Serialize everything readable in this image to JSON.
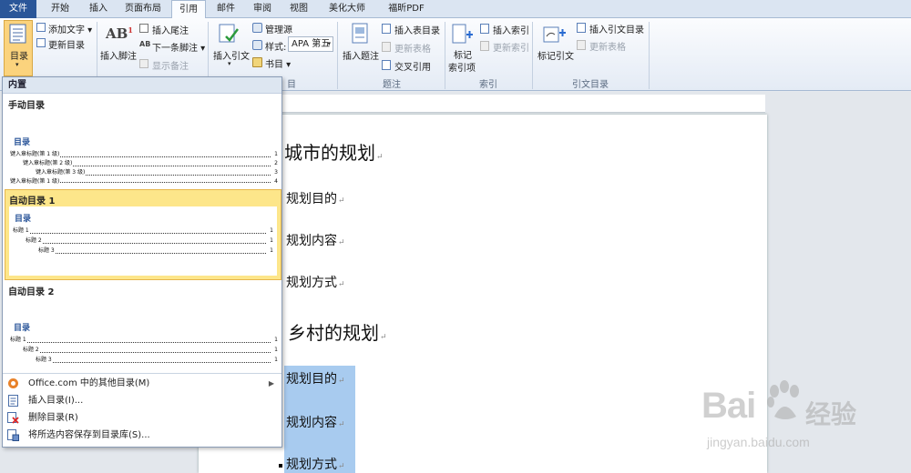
{
  "tabs": [
    "文件",
    "开始",
    "插入",
    "页面布局",
    "引用",
    "邮件",
    "审阅",
    "视图",
    "美化大师",
    "福昕PDF"
  ],
  "ribbon": {
    "toc_button": "目录",
    "add_text": "添加文字 ▾",
    "update_toc": "更新目录",
    "insert_footnote": "插入脚注",
    "insert_endnote": "插入尾注",
    "next_footnote": "下一条脚注 ▾",
    "show_notes": "显示备注",
    "insert_citation": "插入引文",
    "manage_sources": "管理源",
    "style_label": "样式:",
    "style_value": "APA 第五",
    "bibliography": "书目 ▾",
    "insert_caption": "插入题注",
    "insert_table_of_figures": "插入表目录",
    "update_table": "更新表格",
    "cross_reference": "交叉引用",
    "caption_group": "题注",
    "mark_entry": "标记\n索引项",
    "mark_entry_l1": "标记",
    "mark_entry_l2": "索引项",
    "insert_index": "插入索引",
    "update_index": "更新索引",
    "index_group": "索引",
    "mark_citation": "标记引文",
    "insert_toa": "插入引文目录",
    "update_toa": "更新表格",
    "toa_group": "引文目录",
    "citation_group_partial": "目"
  },
  "gallery": {
    "builtin_header": "内置",
    "manual_title": "手动目录",
    "manual_preview": {
      "heading": "目录",
      "lines": [
        {
          "text": "键入章标题(第 1 级)",
          "page": "1"
        },
        {
          "text": "键入章标题(第 2 级)",
          "page": "2"
        },
        {
          "text": "键入章标题(第 3 级)",
          "page": "3"
        },
        {
          "text": "键入章标题(第 1 级)",
          "page": "4"
        }
      ]
    },
    "auto1_title": "自动目录 1",
    "auto1_preview": {
      "heading": "目录",
      "lines": [
        {
          "text": "标题 1",
          "page": "1"
        },
        {
          "text": "标题 2",
          "page": "1"
        },
        {
          "text": "标题 3",
          "page": "1"
        }
      ]
    },
    "auto2_title": "自动目录 2",
    "auto2_preview": {
      "heading": "目录",
      "lines": [
        {
          "text": "标题 1",
          "page": "1"
        },
        {
          "text": "标题 2",
          "page": "1"
        },
        {
          "text": "标题 3",
          "page": "1"
        }
      ]
    },
    "menu": [
      {
        "label": "Office.com 中的其他目录(M)",
        "icon": "office-icon"
      },
      {
        "label": "插入目录(I)...",
        "icon": "insert-toc-icon"
      },
      {
        "label": "删除目录(R)",
        "icon": "remove-toc-icon"
      },
      {
        "label": "将所选内容保存到目录库(S)...",
        "icon": "save-selection-icon"
      }
    ]
  },
  "document": {
    "lines": [
      {
        "text": "城市的规划",
        "level": "h1"
      },
      {
        "text": "规划目的",
        "level": "h2"
      },
      {
        "text": "规划内容",
        "level": "h2"
      },
      {
        "text": "规划方式",
        "level": "h2"
      },
      {
        "text": "乡村的规划",
        "level": "h1"
      },
      {
        "text": "规划目的",
        "level": "h2"
      },
      {
        "text": "规划内容",
        "level": "h2"
      },
      {
        "text": "规划方式",
        "level": "h2"
      }
    ],
    "paragraph_mark": "↵"
  },
  "watermark": {
    "brand_left": "Bai",
    "brand_right": "经验",
    "url": "jingyan.baidu.com"
  },
  "colors": {
    "file_tab": "#2a5699",
    "selection": "#a8cbef",
    "gallery_highlight": "#fde68a",
    "toc_heading": "#2a5599"
  }
}
